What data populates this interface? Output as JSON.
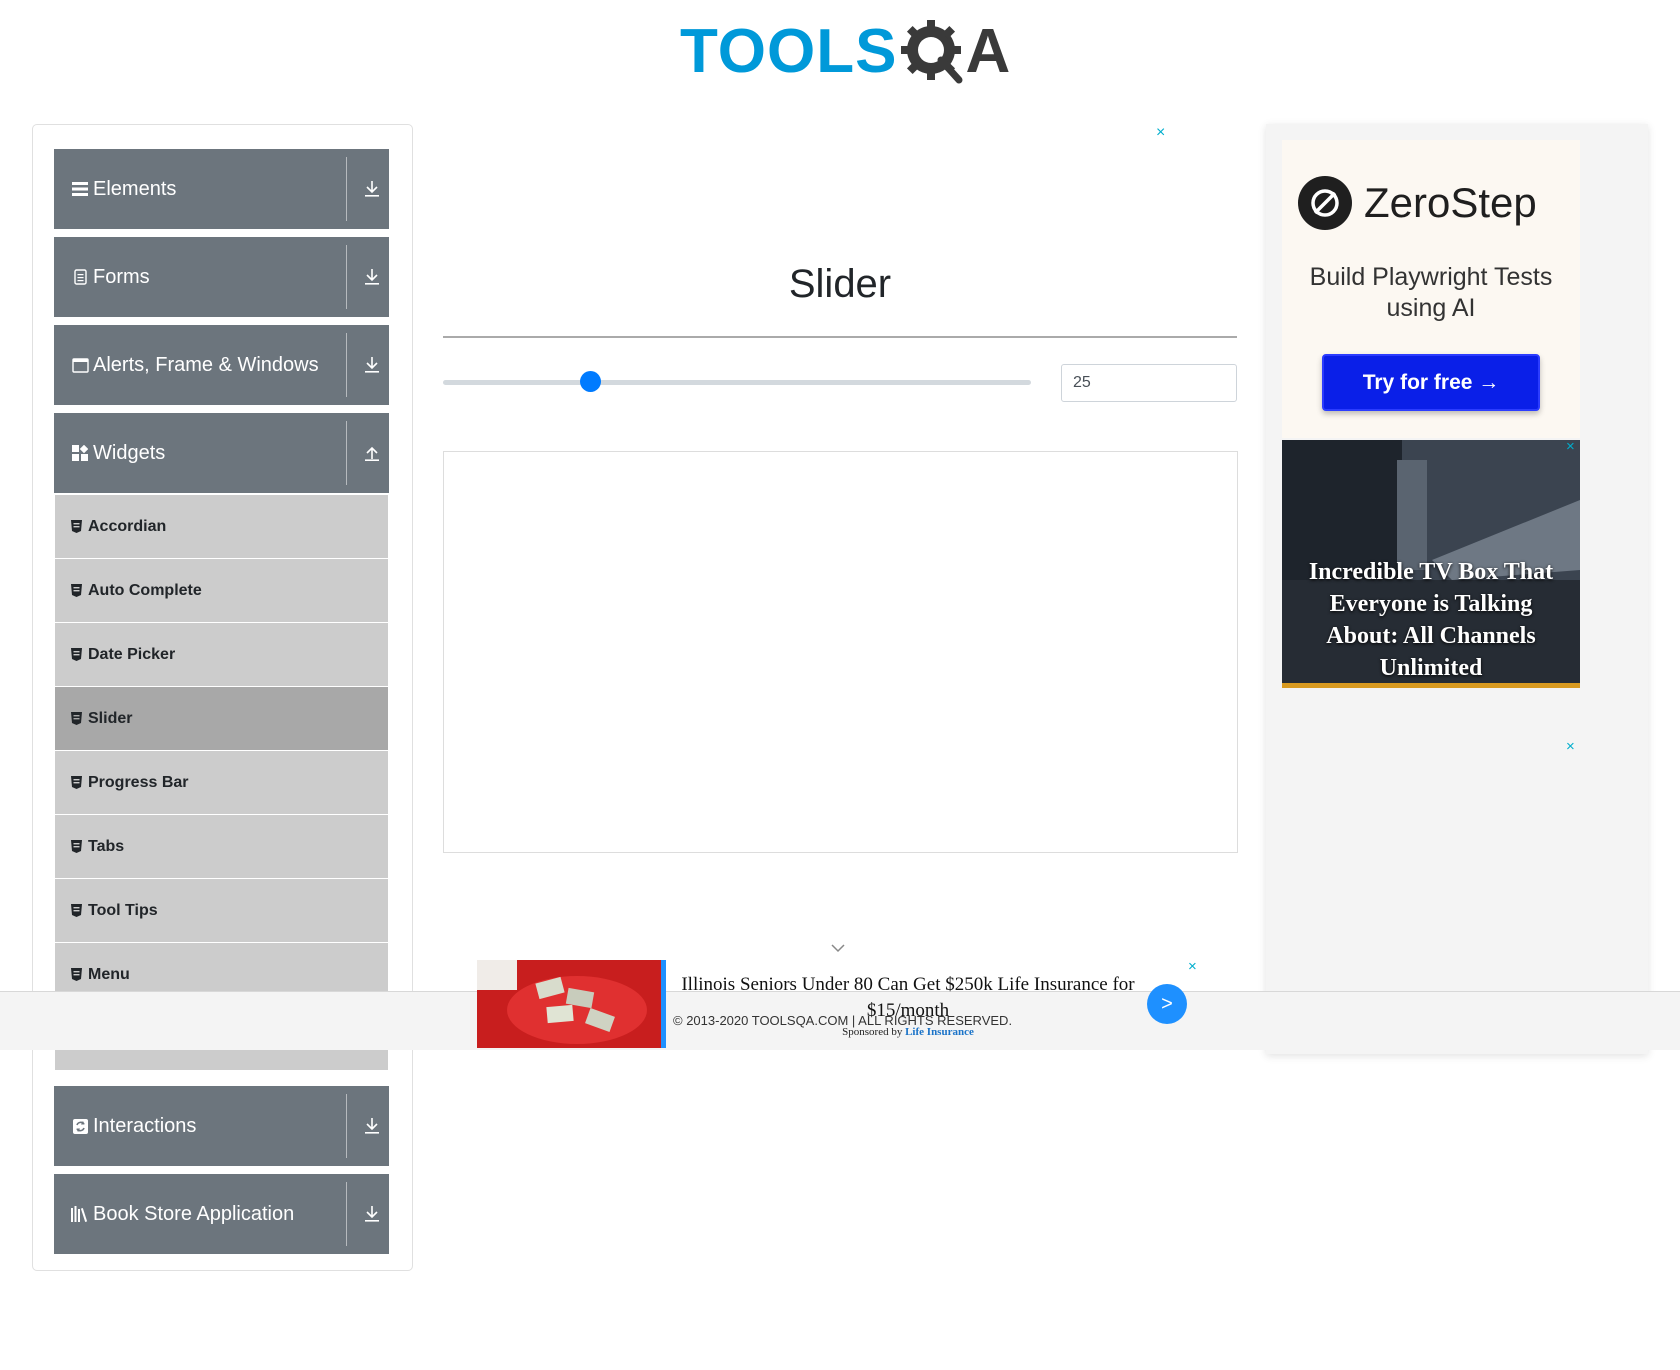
{
  "header": {
    "logo_left": "TOOLS",
    "logo_right": "A"
  },
  "sidebar": {
    "groups": [
      {
        "label": "Elements",
        "icon": "hamburger-icon",
        "expanded": false
      },
      {
        "label": "Forms",
        "icon": "document-icon",
        "expanded": false
      },
      {
        "label": "Alerts, Frame & Windows",
        "icon": "window-icon",
        "expanded": false
      },
      {
        "label": "Widgets",
        "icon": "widgets-icon",
        "expanded": true
      },
      {
        "label": "Interactions",
        "icon": "sync-icon",
        "expanded": false
      },
      {
        "label": "Book Store Application",
        "icon": "books-icon",
        "expanded": false
      }
    ],
    "widget_items": [
      {
        "label": "Accordian"
      },
      {
        "label": "Auto Complete"
      },
      {
        "label": "Date Picker"
      },
      {
        "label": "Slider",
        "active": true
      },
      {
        "label": "Progress Bar"
      },
      {
        "label": "Tabs"
      },
      {
        "label": "Tool Tips"
      },
      {
        "label": "Menu"
      },
      {
        "label": ""
      }
    ]
  },
  "main": {
    "title": "Slider",
    "slider": {
      "value": "25",
      "min": 0,
      "max": 100,
      "accent": "#007bff"
    }
  },
  "ads": {
    "close_glyph": "×",
    "zerostep": {
      "brand": "ZeroStep",
      "tagline": "Build Playwright Tests using AI",
      "button": "Try for free →",
      "button_color": "#0a1fe8"
    },
    "tv_box": {
      "headline": "Incredible TV Box That Everyone is Talking About: All Channels Unlimited"
    },
    "sticky": {
      "headline": "Illinois Seniors Under 80 Can Get $250k Life Insurance for $15/month",
      "sponsored_prefix": "Sponsored by",
      "sponsor": "Life Insurance",
      "go_glyph": ">"
    }
  },
  "footer": {
    "copyright": "© 2013-2020 TOOLSQA.COM | ALL RIGHTS RESERVED."
  },
  "colors": {
    "sidebar_header": "#6c757d",
    "menu_item": "#cccccc",
    "menu_item_active": "#a8a8a8",
    "logo_blue": "#0099d9",
    "ad_close": "#00aecd"
  }
}
